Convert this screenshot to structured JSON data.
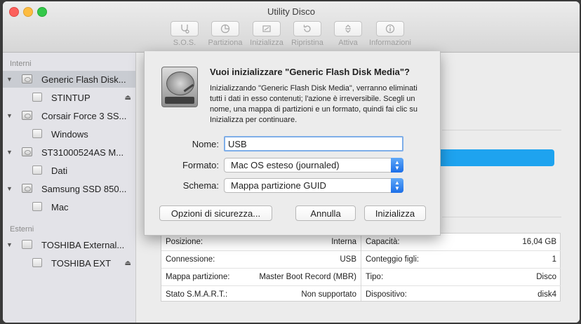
{
  "window": {
    "title": "Utility Disco"
  },
  "toolbar": {
    "items": [
      {
        "label": "S.O.S.",
        "icon": "stethoscope-icon"
      },
      {
        "label": "Partiziona",
        "icon": "partition-pie-icon"
      },
      {
        "label": "Inizializza",
        "icon": "erase-icon"
      },
      {
        "label": "Ripristina",
        "icon": "restore-arrow-icon"
      },
      {
        "label": "Attiva",
        "icon": "mount-arrows-icon"
      },
      {
        "label": "Informazioni",
        "icon": "info-icon"
      }
    ]
  },
  "sidebar": {
    "internal_header": "Interni",
    "external_header": "Esterni",
    "items": [
      {
        "label": "Generic Flash Disk...",
        "kind": "disk"
      },
      {
        "label": "STINTUP",
        "kind": "volume",
        "eject": "⏏"
      },
      {
        "label": "Corsair Force 3 SS...",
        "kind": "disk"
      },
      {
        "label": "Windows",
        "kind": "volume"
      },
      {
        "label": "ST31000524AS M...",
        "kind": "disk"
      },
      {
        "label": "Dati",
        "kind": "volume"
      },
      {
        "label": "Samsung SSD 850...",
        "kind": "disk"
      },
      {
        "label": "Mac",
        "kind": "volume"
      },
      {
        "label": "TOSHIBA External...",
        "kind": "external-disk"
      },
      {
        "label": "TOSHIBA EXT",
        "kind": "volume",
        "eject": "⏏"
      }
    ]
  },
  "sheet": {
    "title": "Vuoi inizializzare \"Generic Flash Disk Media\"?",
    "message": "Inizializzando \"Generic Flash Disk Media\", verranno eliminati tutti i dati in esso contenuti; l'azione è irreversibile. Scegli un nome, una mappa di partizioni e un formato, quindi fai clic su Inizializza per continuare.",
    "name_label": "Nome:",
    "name_value": "USB",
    "format_label": "Formato:",
    "format_value": "Mac OS esteso (journaled)",
    "scheme_label": "Schema:",
    "scheme_value": "Mappa partizione GUID",
    "security_button": "Opzioni di sicurezza...",
    "cancel_button": "Annulla",
    "erase_button": "Inizializza"
  },
  "info": {
    "left": [
      {
        "key": "Posizione:",
        "value": "Interna"
      },
      {
        "key": "Connessione:",
        "value": "USB"
      },
      {
        "key": "Mappa partizione:",
        "value": "Master Boot Record (MBR)"
      },
      {
        "key": "Stato S.M.A.R.T.:",
        "value": "Non supportato"
      }
    ],
    "right": [
      {
        "key": "Capacità:",
        "value": "16,04 GB"
      },
      {
        "key": "Conteggio figli:",
        "value": "1"
      },
      {
        "key": "Tipo:",
        "value": "Disco"
      },
      {
        "key": "Dispositivo:",
        "value": "disk4"
      }
    ]
  },
  "colors": {
    "usage_bar": "#1ea3ef",
    "accent": "#1c6fe8"
  }
}
